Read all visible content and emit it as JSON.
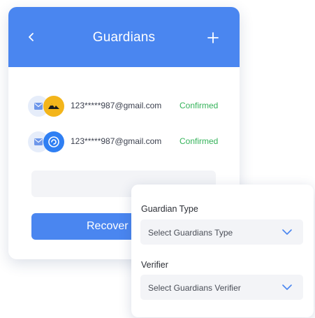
{
  "header": {
    "title": "Guardians",
    "back_icon": "chevron-left-icon",
    "add_icon": "plus-icon"
  },
  "guardians": [
    {
      "email": "123*****987@gmail.com",
      "status": "Confirmed",
      "verifier_icon": "mountain-verifier-icon",
      "verifier_color": "#f3b51b"
    },
    {
      "email": "123*****987@gmail.com",
      "status": "Confirmed",
      "verifier_icon": "swirl-verifier-icon",
      "verifier_color": "#2f7ff3"
    }
  ],
  "recover_button": {
    "label": "Recover"
  },
  "popup": {
    "guardian_type": {
      "label": "Guardian Type",
      "value": "Select Guardians Type"
    },
    "verifier": {
      "label": "Verifier",
      "value": "Select Guardians Verifier"
    }
  },
  "colors": {
    "primary": "#4a86f0",
    "confirmed": "#35b35a",
    "field_bg": "#f3f4f7"
  }
}
